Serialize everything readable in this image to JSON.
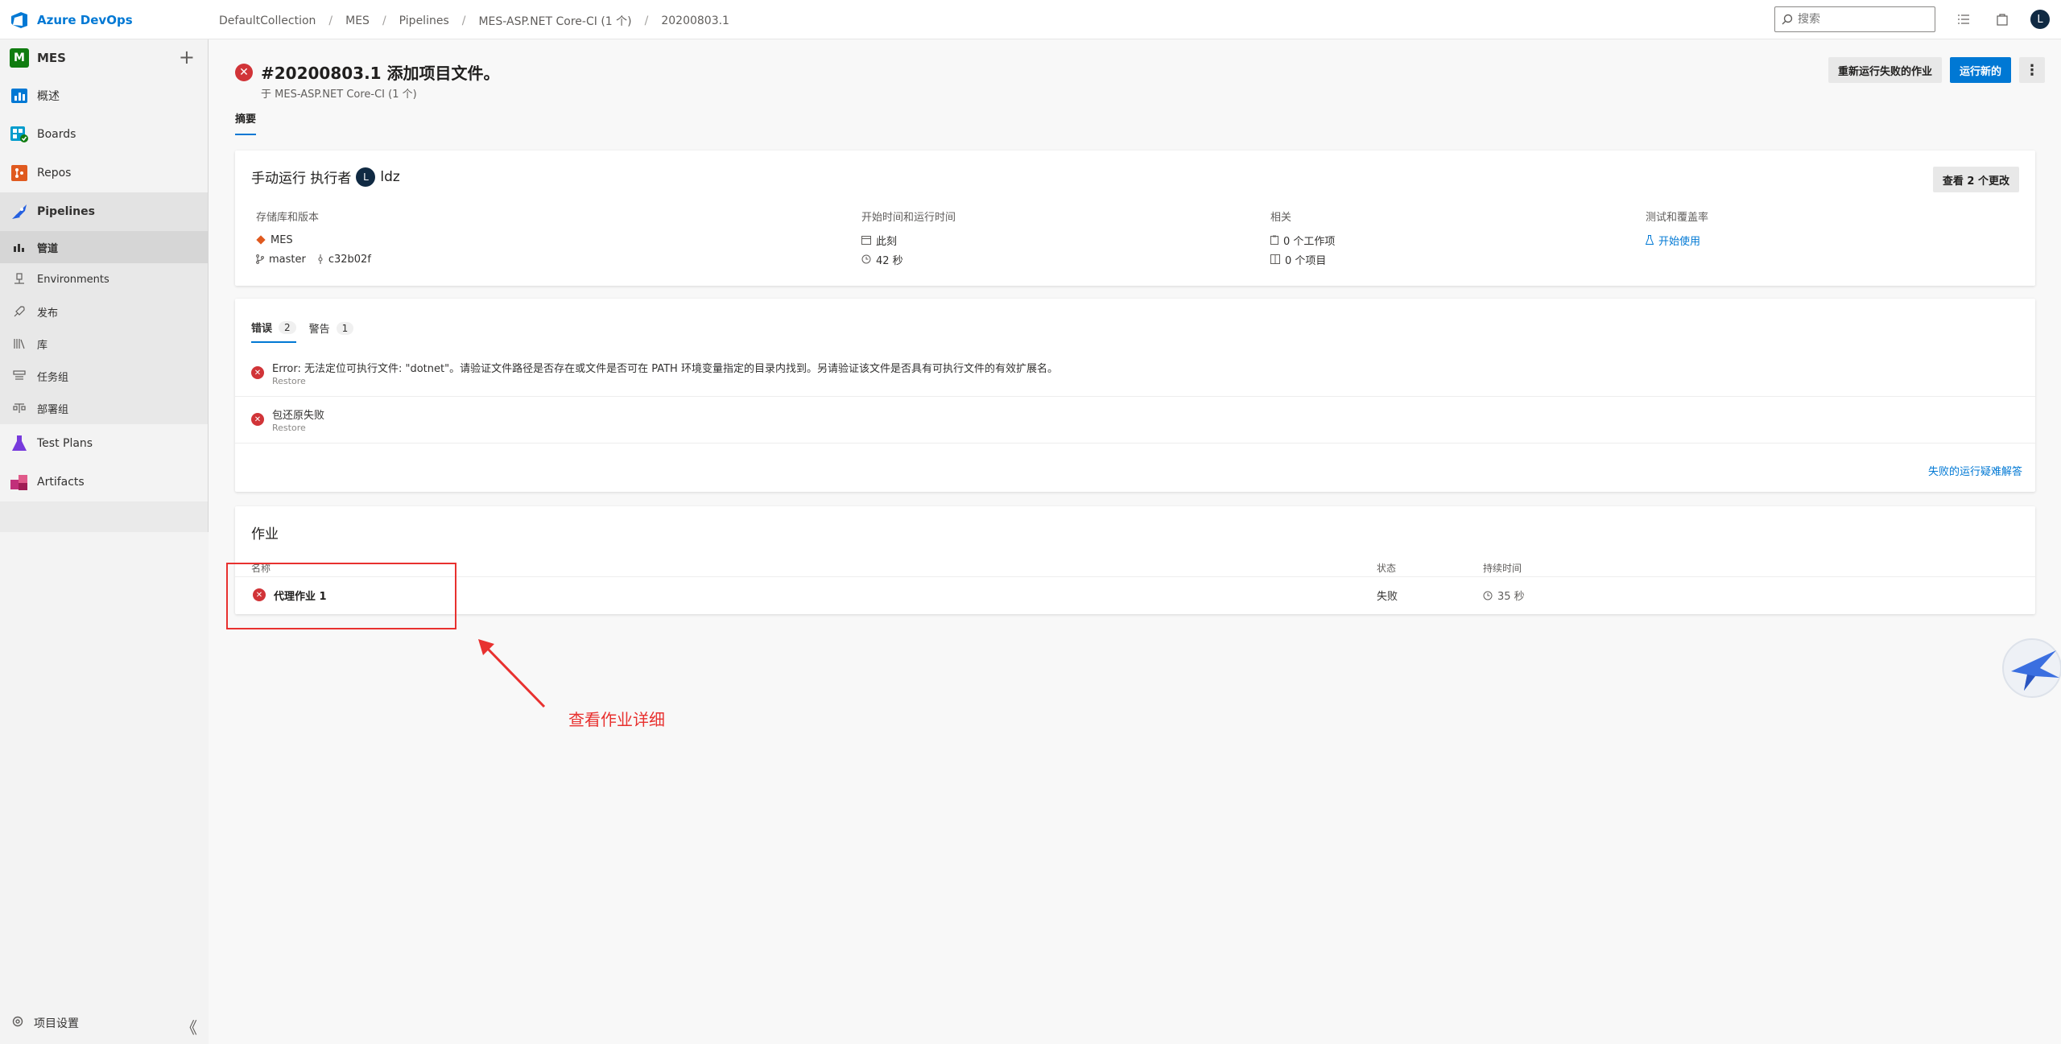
{
  "brand": {
    "name": "Azure DevOps"
  },
  "breadcrumb": [
    "DefaultCollection",
    "MES",
    "Pipelines",
    "MES-ASP.NET Core-CI (1 个)",
    "20200803.1"
  ],
  "search": {
    "placeholder": "搜索"
  },
  "user": {
    "initial": "L"
  },
  "project": {
    "badge": "M",
    "name": "MES",
    "add_symbol": "+"
  },
  "nav": {
    "items": [
      {
        "label": "概述"
      },
      {
        "label": "Boards"
      },
      {
        "label": "Repos"
      },
      {
        "label": "Pipelines"
      }
    ],
    "pipelines_sub": [
      {
        "label": "管道"
      },
      {
        "label": "Environments"
      },
      {
        "label": "发布"
      },
      {
        "label": "库"
      },
      {
        "label": "任务组"
      },
      {
        "label": "部署组"
      }
    ],
    "after": [
      {
        "label": "Test Plans"
      },
      {
        "label": "Artifacts"
      }
    ],
    "settings": "项目设置",
    "collapse_symbol": "《"
  },
  "run": {
    "title": "#20200803.1 添加项目文件。",
    "subtitle": "于 MES-ASP.NET Core-CI (1 个)",
    "rerun_label": "重新运行失败的作业",
    "run_new_label": "运行新的",
    "more_symbol": "⋮"
  },
  "tabs": {
    "summary": "摘要"
  },
  "summary": {
    "trigger_text": "手动运行 执行者",
    "user_initial": "L",
    "user_name": "ldz",
    "changes_button": "查看 2 个更改",
    "repo_label": "存储库和版本",
    "repo_name": "MES",
    "branch": "master",
    "commit": "c32b02f",
    "time_label": "开始时间和运行时间",
    "start": "此刻",
    "duration": "42 秒",
    "related_label": "相关",
    "work_items": "0 个工作项",
    "artifacts": "0 个项目",
    "tests_label": "测试和覆盖率",
    "tests_link": "开始使用"
  },
  "errors": {
    "tab_errors": "错误",
    "errors_count": "2",
    "tab_warnings": "警告",
    "warnings_count": "1",
    "rows": [
      {
        "message": "Error: 无法定位可执行文件: \"dotnet\"。请验证文件路径是否存在或文件是否可在 PATH 环境变量指定的目录内找到。另请验证该文件是否具有可执行文件的有效扩展名。",
        "source": "Restore"
      },
      {
        "message": "包还原失败",
        "source": "Restore"
      }
    ],
    "troubleshoot_link": "失败的运行疑难解答"
  },
  "jobs": {
    "title": "作业",
    "col_name": "名称",
    "col_status": "状态",
    "col_duration": "持续时间",
    "rows": [
      {
        "name": "代理作业 1",
        "status": "失败",
        "duration": "35 秒"
      }
    ]
  },
  "annotation": {
    "text": "查看作业详细"
  },
  "colors": {
    "accent": "#0078d4",
    "error": "#d13438",
    "annotation": "#e8312f"
  }
}
